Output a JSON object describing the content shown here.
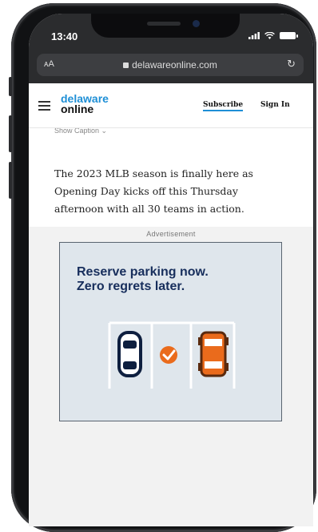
{
  "status_bar": {
    "time": "13:40",
    "signal_icon": "signal-bars-icon",
    "wifi_icon": "wifi-icon",
    "battery_icon": "battery-icon"
  },
  "browser": {
    "text_size_label": "ᴀA",
    "url": "delawareonline.com",
    "lock_icon": "lock-icon",
    "reload_icon": "reload-icon"
  },
  "site": {
    "menu_icon": "hamburger-menu-icon",
    "logo_line1": "delaware",
    "logo_line2": "online",
    "subscribe_label": "Subscribe",
    "signin_label": "Sign In",
    "accent_color": "#1e8fd6"
  },
  "article": {
    "caption_toggle": "Show Caption ⌄",
    "paragraph": "The 2023 MLB season is finally here as Opening Day kicks off this Thursday afternoon with all 30 teams in action."
  },
  "ad": {
    "label": "Advertisement",
    "headline_line1": "Reserve parking now.",
    "headline_line2": "Zero regrets later.",
    "headline_color": "#172e5c",
    "art": [
      "parking-lot-icon",
      "blue-car-icon",
      "orange-checkmark-icon",
      "orange-car-icon"
    ]
  }
}
